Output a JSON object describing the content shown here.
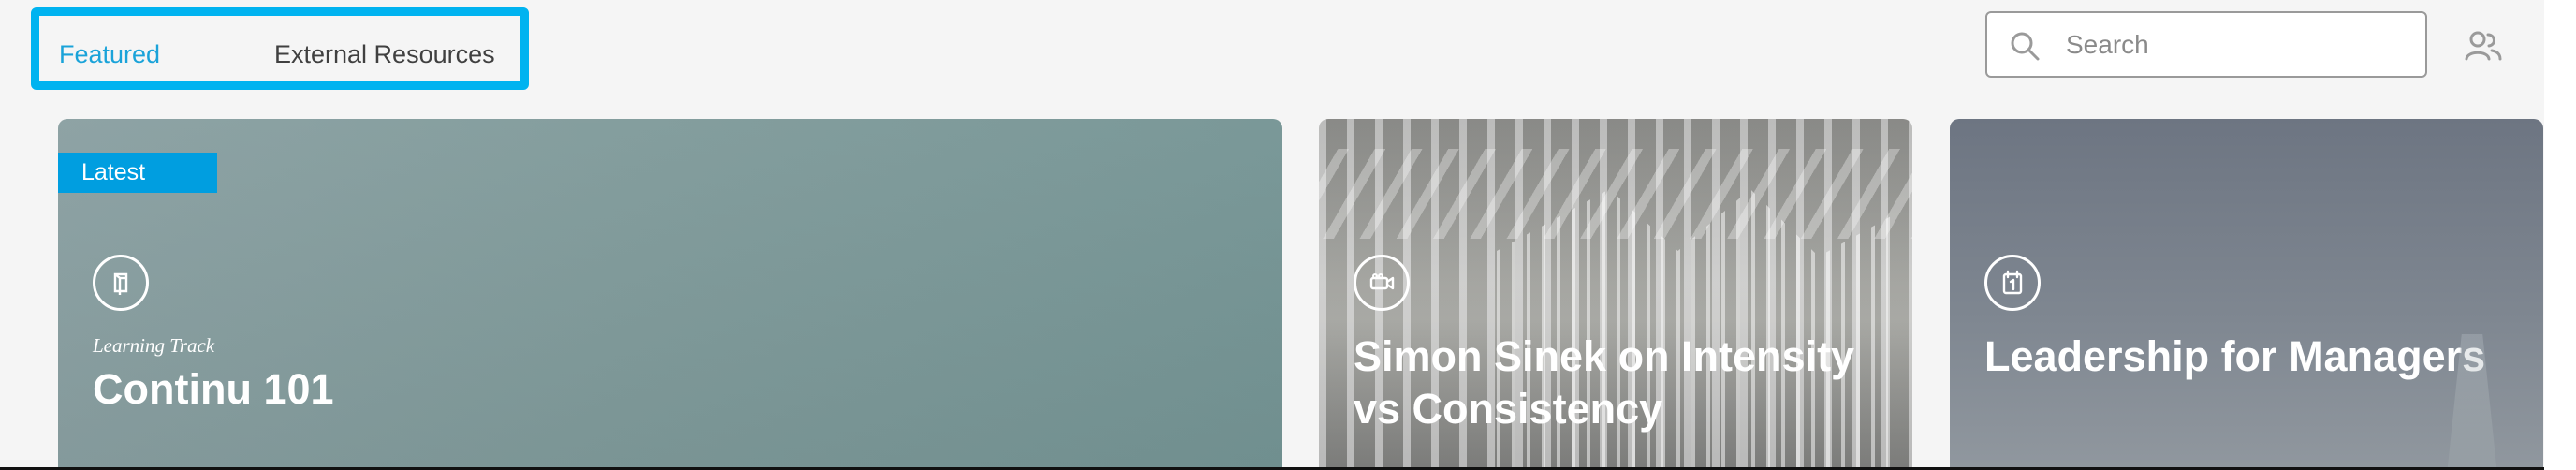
{
  "tabs": {
    "featured": "Featured",
    "external_resources": "External Resources"
  },
  "search": {
    "placeholder": "Search"
  },
  "cards": [
    {
      "badge": "Latest",
      "kicker": "Learning Track",
      "title": "Continu 101",
      "icon": "book-icon"
    },
    {
      "title": "Simon Sinek on Intensity vs Consistency",
      "icon": "video-camera-icon"
    },
    {
      "title": "Leadership for Managers",
      "icon": "calendar-icon"
    }
  ],
  "colors": {
    "accent": "#00b3f0",
    "featured_tab": "#1aa3d9",
    "badge": "#009ee0",
    "page_background": "#f5f5f5"
  },
  "icons": {
    "search": "search-icon",
    "people": "people-icon"
  }
}
